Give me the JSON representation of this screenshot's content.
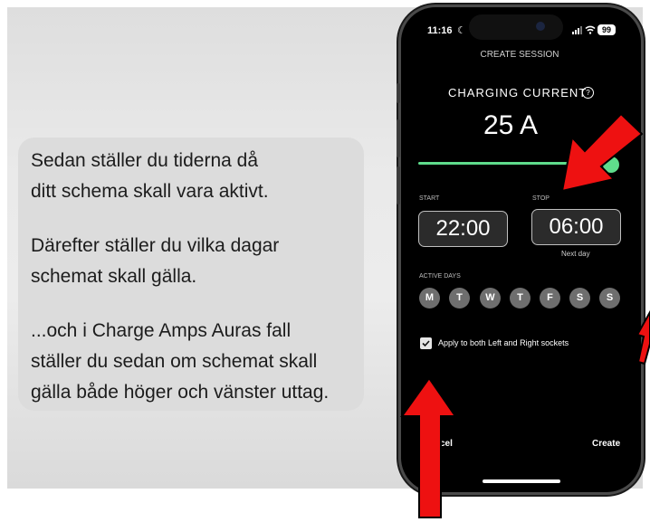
{
  "caption": {
    "lines": [
      "Sedan ställer du tiderna då",
      "ditt schema skall vara aktivt.",
      "Därefter ställer du vilka dagar",
      "schemat skall gälla.",
      "...och i Charge Amps Auras fall",
      "ställer du sedan om schemat skall",
      "gälla både höger och vänster uttag."
    ]
  },
  "status_bar": {
    "time": "11:16",
    "battery": "99"
  },
  "screen": {
    "title": "CREATE SESSION",
    "current_label": "CHARGING CURRENT",
    "current_value": "25 A",
    "current_fraction": 1.0,
    "start_label": "START",
    "start_time": "22:00",
    "stop_label": "STOP",
    "stop_time": "06:00",
    "next_day": "Next day",
    "active_days_label": "ACTIVE DAYS",
    "days": [
      "M",
      "T",
      "W",
      "T",
      "F",
      "S",
      "S"
    ],
    "apply_label": "Apply to both Left and Right sockets",
    "apply_checked": true,
    "cancel_label": "cel",
    "create_label": "Create"
  },
  "colors": {
    "slider": "#5fdc8c",
    "arrow": "#ee1111",
    "day_circle": "#6e6e6e"
  }
}
